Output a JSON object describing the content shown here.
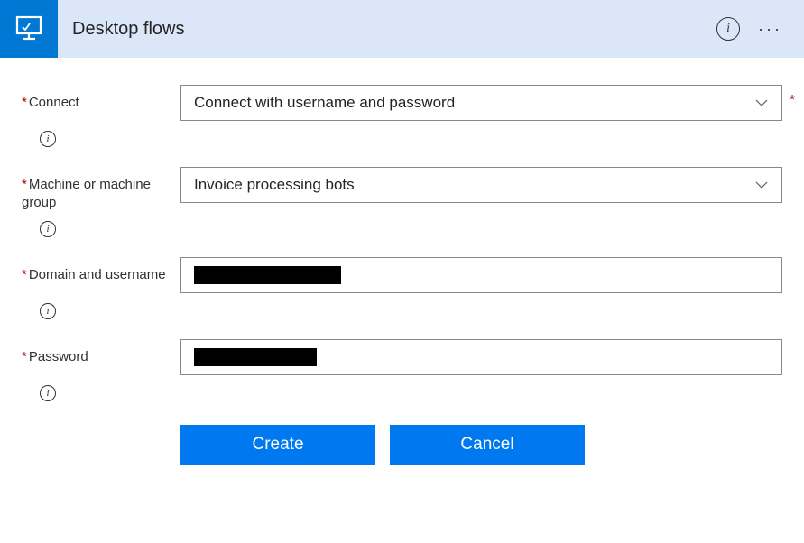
{
  "header": {
    "title": "Desktop flows",
    "info_tooltip": "i",
    "ellipsis": "···"
  },
  "fields": {
    "connect": {
      "label": "Connect",
      "value": "Connect with username and password"
    },
    "machine": {
      "label": "Machine or machine group",
      "value": "Invoice processing bots"
    },
    "domain": {
      "label": "Domain and username"
    },
    "password": {
      "label": "Password"
    }
  },
  "buttons": {
    "create": "Create",
    "cancel": "Cancel"
  }
}
